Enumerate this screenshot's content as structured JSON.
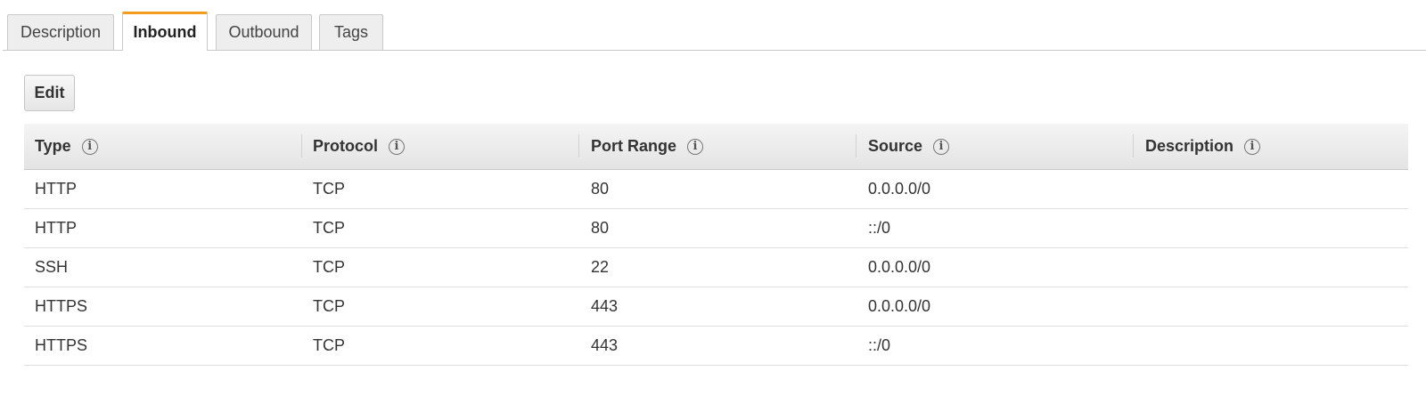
{
  "tabs": [
    {
      "label": "Description"
    },
    {
      "label": "Inbound"
    },
    {
      "label": "Outbound"
    },
    {
      "label": "Tags"
    }
  ],
  "active_tab": "Inbound",
  "accent_color": "#f39c1f",
  "edit_button": {
    "label": "Edit"
  },
  "table": {
    "columns": [
      {
        "label": "Type",
        "icon": "info-icon"
      },
      {
        "label": "Protocol",
        "icon": "info-icon"
      },
      {
        "label": "Port Range",
        "icon": "info-icon"
      },
      {
        "label": "Source",
        "icon": "info-icon"
      },
      {
        "label": "Description",
        "icon": "info-icon"
      }
    ],
    "rows": [
      {
        "type": "HTTP",
        "protocol": "TCP",
        "port_range": "80",
        "source": "0.0.0.0/0",
        "description": ""
      },
      {
        "type": "HTTP",
        "protocol": "TCP",
        "port_range": "80",
        "source": "::/0",
        "description": ""
      },
      {
        "type": "SSH",
        "protocol": "TCP",
        "port_range": "22",
        "source": "0.0.0.0/0",
        "description": ""
      },
      {
        "type": "HTTPS",
        "protocol": "TCP",
        "port_range": "443",
        "source": "0.0.0.0/0",
        "description": ""
      },
      {
        "type": "HTTPS",
        "protocol": "TCP",
        "port_range": "443",
        "source": "::/0",
        "description": ""
      }
    ]
  }
}
